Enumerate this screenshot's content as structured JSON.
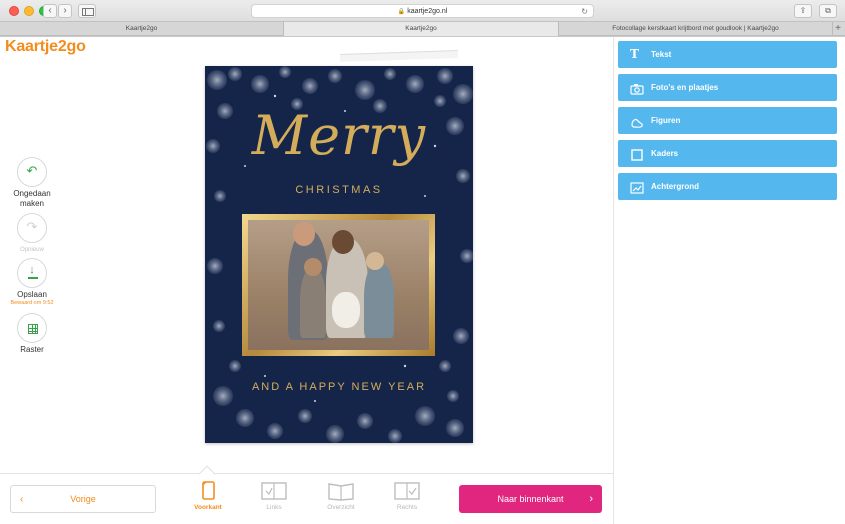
{
  "browser": {
    "url": "kaartje2go.nl",
    "tabs": [
      {
        "label": "Kaartje2go",
        "active": false
      },
      {
        "label": "Kaartje2go",
        "active": true
      },
      {
        "label": "Fotocollage kerstkaart krijtbord met goudlook | Kaartje2go",
        "active": false
      }
    ],
    "new_tab": "+"
  },
  "logo": "Kaartje2go",
  "tools": {
    "undo": "Ongedaan maken",
    "redo": "Opnieuw",
    "save": "Opslaan",
    "save_status": "Bewaard om 9:52",
    "grid": "Raster"
  },
  "card": {
    "title": "Merry",
    "subtitle": "CHRISTMAS",
    "footer": "AND A HAPPY NEW YEAR"
  },
  "bottom": {
    "prev": "Vorige",
    "next": "Naar binnenkant",
    "views": [
      {
        "label": "Voorkant",
        "active": true
      },
      {
        "label": "Links",
        "active": false
      },
      {
        "label": "Overzicht",
        "active": false
      },
      {
        "label": "Rechts",
        "active": false
      }
    ]
  },
  "panel": {
    "items": [
      {
        "label": "Tekst",
        "icon": "text-icon"
      },
      {
        "label": "Foto's en plaatjes",
        "icon": "camera-icon"
      },
      {
        "label": "Figuren",
        "icon": "shapes-icon"
      },
      {
        "label": "Kaders",
        "icon": "frame-icon"
      },
      {
        "label": "Achtergrond",
        "icon": "background-icon"
      }
    ]
  },
  "colors": {
    "brand_orange": "#f28d1e",
    "accent_pink": "#e0267f",
    "panel_blue": "#54b7ee",
    "card_navy": "#15254a",
    "gold": "#d4ad5a",
    "tool_green": "#3aa04a"
  }
}
